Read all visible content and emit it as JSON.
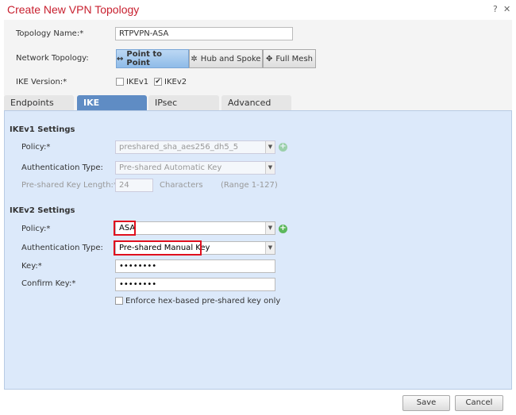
{
  "dialog": {
    "title": "Create New VPN Topology",
    "help_icon": "?",
    "close_icon": "✕"
  },
  "top": {
    "topology_name_label": "Topology Name:*",
    "topology_name_value": "RTPVPN-ASA",
    "network_topology_label": "Network Topology:",
    "topology_options": [
      {
        "label": "Point to Point",
        "icon": "↔",
        "selected": true
      },
      {
        "label": "Hub and Spoke",
        "icon": "✲",
        "selected": false
      },
      {
        "label": "Full Mesh",
        "icon": "✥",
        "selected": false
      }
    ],
    "ike_version_label": "IKE Version:*",
    "ikev1": {
      "label": "IKEv1",
      "checked": false
    },
    "ikev2": {
      "label": "IKEv2",
      "checked": true
    }
  },
  "tabs": [
    {
      "label": "Endpoints"
    },
    {
      "label": "IKE",
      "active": true
    },
    {
      "label": "IPsec"
    },
    {
      "label": "Advanced"
    }
  ],
  "ikev1": {
    "heading": "IKEv1 Settings",
    "policy_label": "Policy:*",
    "policy_value": "preshared_sha_aes256_dh5_5",
    "auth_label": "Authentication Type:",
    "auth_value": "Pre-shared Automatic Key",
    "psk_len_label": "Pre-shared Key Length:*",
    "psk_len_value": "24",
    "characters": "Characters",
    "range": "(Range 1-127)"
  },
  "ikev2": {
    "heading": "IKEv2 Settings",
    "policy_label": "Policy:*",
    "policy_value": "ASA",
    "auth_label": "Authentication Type:",
    "auth_value": "Pre-shared Manual Key",
    "key_label": "Key:*",
    "key_value": "••••••••",
    "confirm_label": "Confirm Key:*",
    "confirm_value": "••••••••",
    "hex_label": "Enforce hex-based pre-shared key only",
    "hex_checked": false
  },
  "footer": {
    "save": "Save",
    "cancel": "Cancel"
  },
  "colors": {
    "title": "#c8202f",
    "panel": "#dce9fa",
    "active_tab": "#5f8cc4",
    "highlight": "#e0101e"
  }
}
